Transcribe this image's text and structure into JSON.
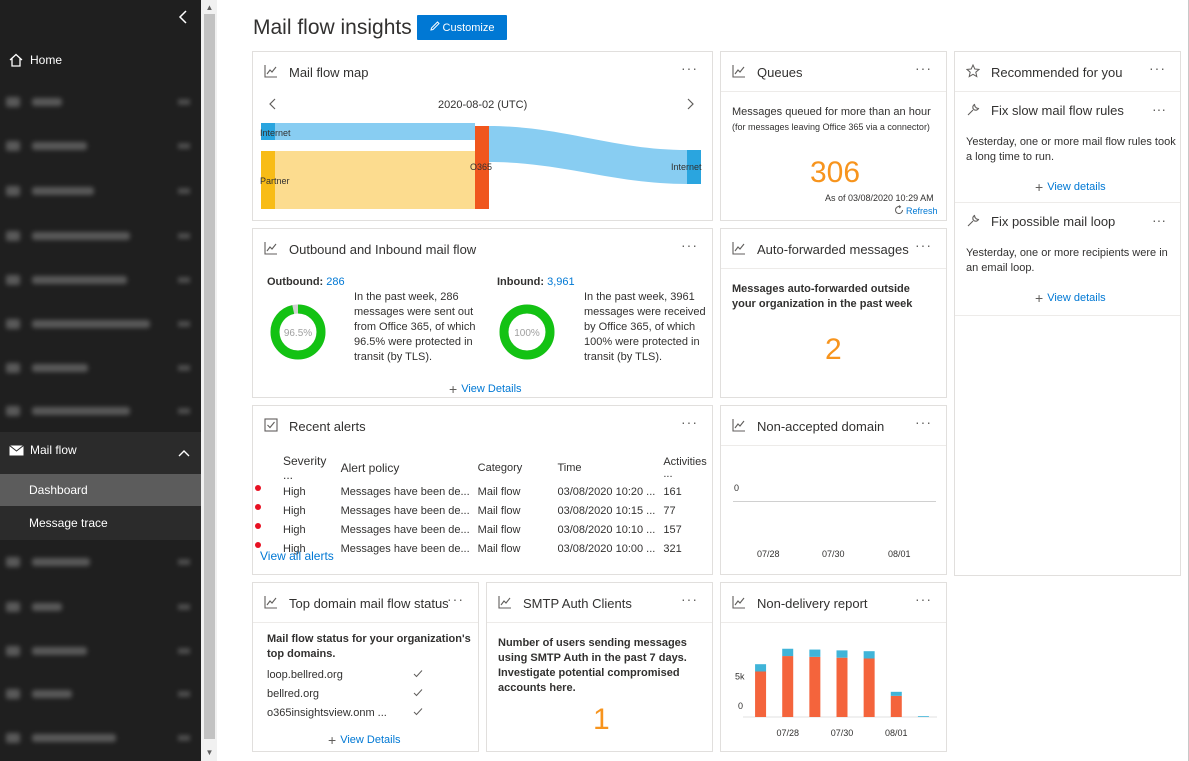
{
  "sidebar": {
    "home_label": "Home",
    "mailflow_label": "Mail flow",
    "sub_items": [
      "Dashboard",
      "Message trace"
    ]
  },
  "page": {
    "title": "Mail flow insights",
    "customize_label": "Customize"
  },
  "cards": {
    "map": {
      "title": "Mail flow map",
      "date": "2020-08-02 (UTC)",
      "nodes": {
        "internet_left": "Internet",
        "partner": "Partner",
        "o365": "O365",
        "internet_right": "Internet"
      }
    },
    "queues": {
      "title": "Queues",
      "heading": "Messages queued for more than an hour",
      "sub": "(for messages leaving Office 365 via a connector)",
      "value": "306",
      "as_of": "As of 03/08/2020 10:29 AM",
      "refresh": "Refresh"
    },
    "recommended": {
      "title": "Recommended for you",
      "items": [
        {
          "title": "Fix slow mail flow rules",
          "text": "Yesterday, one or more mail flow rules took a long time to run.",
          "link": "View details"
        },
        {
          "title": "Fix possible mail loop",
          "text": "Yesterday, one or more recipients were in an email loop.",
          "link": "View details"
        }
      ]
    },
    "outbound": {
      "title": "Outbound and Inbound mail flow",
      "out_label": "Outbound:",
      "out_count": "286",
      "out_pct_label": "96.5%",
      "out_pct": 96.5,
      "out_text": "In the past week, 286 messages were sent out from Office 365, of which 96.5% were protected in transit (by TLS).",
      "in_label": "Inbound:",
      "in_count": "3,961",
      "in_pct_label": "100%",
      "in_pct": 100,
      "in_text": "In the past week, 3961 messages were received by Office 365, of which 100% were protected in transit (by TLS).",
      "link": "View Details"
    },
    "autofwd": {
      "title": "Auto-forwarded messages",
      "text": "Messages auto-forwarded outside your organization in the past week",
      "value": "2"
    },
    "alerts": {
      "title": "Recent alerts",
      "columns": [
        "Severity ...",
        "Alert policy",
        "Category",
        "Time",
        "Activities ..."
      ],
      "rows": [
        [
          "High",
          "Messages have been de...",
          "Mail flow",
          "03/08/2020 10:20 ...",
          "161"
        ],
        [
          "High",
          "Messages have been de...",
          "Mail flow",
          "03/08/2020 10:15 ...",
          "77"
        ],
        [
          "High",
          "Messages have been de...",
          "Mail flow",
          "03/08/2020 10:10 ...",
          "157"
        ],
        [
          "High",
          "Messages have been de...",
          "Mail flow",
          "03/08/2020 10:00 ...",
          "321"
        ]
      ],
      "link": "View all alerts"
    },
    "nonaccepted": {
      "title": "Non-accepted domain",
      "y_label": "0",
      "x_labels": [
        "07/28",
        "07/30",
        "08/01"
      ]
    },
    "topdomain": {
      "title": "Top domain mail flow status",
      "text": "Mail flow status for your organization's top domains.",
      "domains": [
        "loop.bellred.org",
        "bellred.org",
        "o365insightsview.onm ..."
      ],
      "link": "View Details"
    },
    "smtp": {
      "title": "SMTP Auth Clients",
      "text": "Number of users sending messages using SMTP Auth in the past 7 days. Investigate potential compromised accounts here.",
      "value": "1"
    },
    "ndr": {
      "title": "Non-delivery report",
      "y_labels": [
        "5k",
        "0"
      ],
      "x_labels": [
        "07/28",
        "07/30",
        "08/01"
      ]
    }
  },
  "chart_data": {
    "type": "bar",
    "categories": [
      "",
      "07/28",
      "",
      "07/30",
      "",
      "08/01",
      ""
    ],
    "series": [
      {
        "values": [
          5600,
          7500,
          7400,
          7300,
          7200,
          2600,
          0
        ]
      },
      {
        "values": [
          900,
          900,
          900,
          900,
          900,
          500,
          100
        ]
      }
    ],
    "ylim": [
      0,
      8000
    ],
    "stacked": true,
    "colors": [
      "#f4643c",
      "#40b4d8"
    ]
  },
  "colors": {
    "accent": "#0078d4",
    "number": "#f7941d",
    "donut_green": "#13c213",
    "internet": "#2aa5df",
    "partner": "#f8bc16",
    "o365": "#f0561d"
  }
}
